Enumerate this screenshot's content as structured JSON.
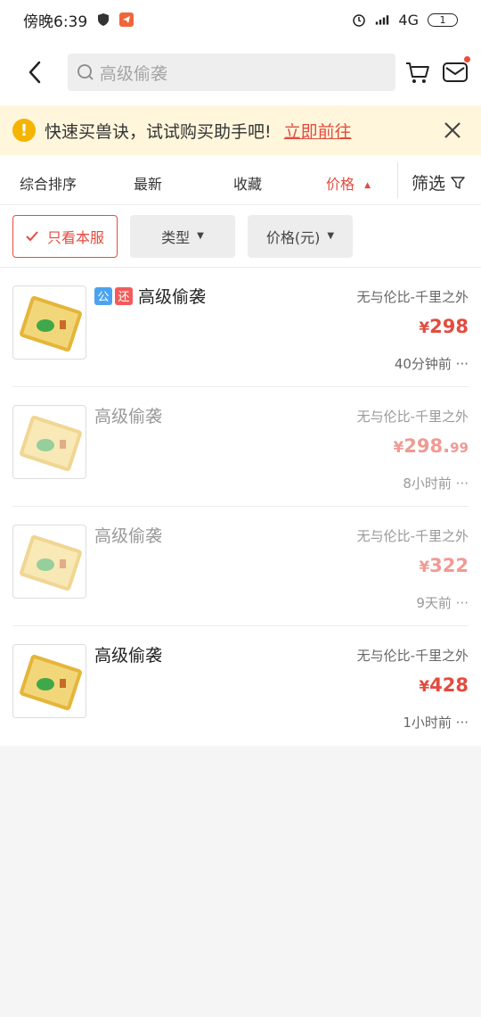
{
  "status": {
    "time": "傍晚6:39",
    "network": "4G",
    "battery": "1"
  },
  "search": {
    "placeholder": "高级偷袭"
  },
  "notice": {
    "text": "快速买兽诀，试试购买助手吧!",
    "link": "立即前往"
  },
  "sort": {
    "items": [
      "综合排序",
      "最新",
      "收藏",
      "价格"
    ],
    "filter": "筛选",
    "active": "价格"
  },
  "filters": {
    "only_server": "只看本服",
    "type": "类型",
    "price": "价格(元)"
  },
  "items": [
    {
      "tags": [
        "公",
        "还"
      ],
      "title": "高级偷袭",
      "server": "无与伦比-千里之外",
      "currency": "¥",
      "price": "298",
      "decimal": "",
      "time": "40分钟前 ···",
      "faded": false
    },
    {
      "tags": [],
      "title": "高级偷袭",
      "server": "无与伦比-千里之外",
      "currency": "¥",
      "price": "298.",
      "decimal": "99",
      "time": "8小时前 ···",
      "faded": true
    },
    {
      "tags": [],
      "title": "高级偷袭",
      "server": "无与伦比-千里之外",
      "currency": "¥",
      "price": "322",
      "decimal": "",
      "time": "9天前 ···",
      "faded": true
    },
    {
      "tags": [],
      "title": "高级偷袭",
      "server": "无与伦比-千里之外",
      "currency": "¥",
      "price": "428",
      "decimal": "",
      "time": "1小时前 ···",
      "faded": false
    }
  ],
  "colors": {
    "accent": "#e34c3f",
    "notice_bg": "#fff6dc",
    "tag_gong": "#4ba3f0",
    "tag_huan": "#f25b5b"
  }
}
